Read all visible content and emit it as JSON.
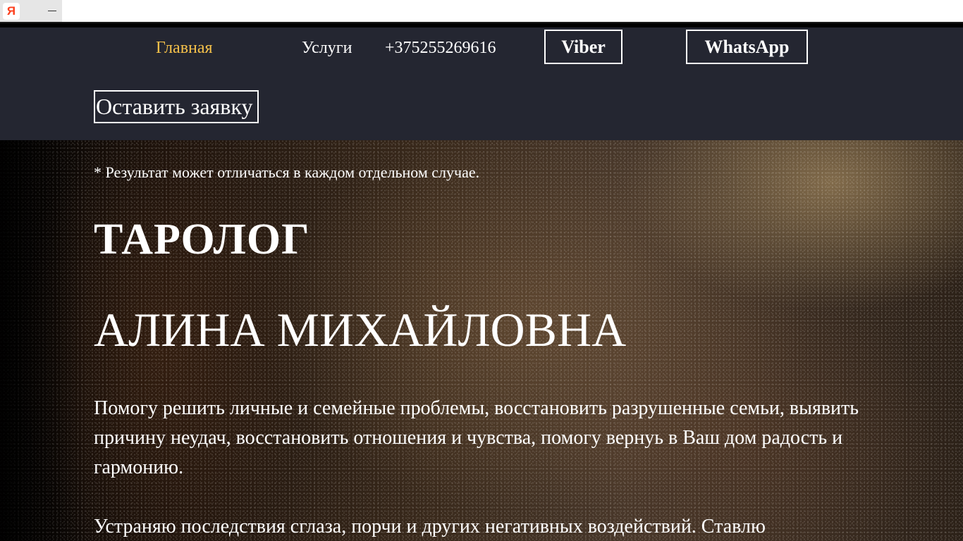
{
  "browser": {
    "tab_icon_letter": "Я"
  },
  "nav": {
    "home": "Главная",
    "services": "Услуги",
    "phone": "+375255269616",
    "viber": "Viber",
    "whatsapp": "WhatsApp",
    "request": "Оставить заявку"
  },
  "hero": {
    "disclaimer": "* Результат может отличаться в каждом отдельном случае.",
    "title": "ТАРОЛОГ",
    "name": "АЛИНА МИХАЙЛОВНА",
    "paragraph_1": "Помогу решить личные и семейные проблемы, восстановить разрушенные семьи, выявить причину неудач, восстановить отношения и чувства, помогу вернуь в Ваш дом радость и гармонию.",
    "paragraph_2": "Устраняю последствия сглаза, порчи и других негативных воздействий. Ставлю"
  },
  "colors": {
    "header_bg": "#242631",
    "accent": "#f4c04a"
  }
}
